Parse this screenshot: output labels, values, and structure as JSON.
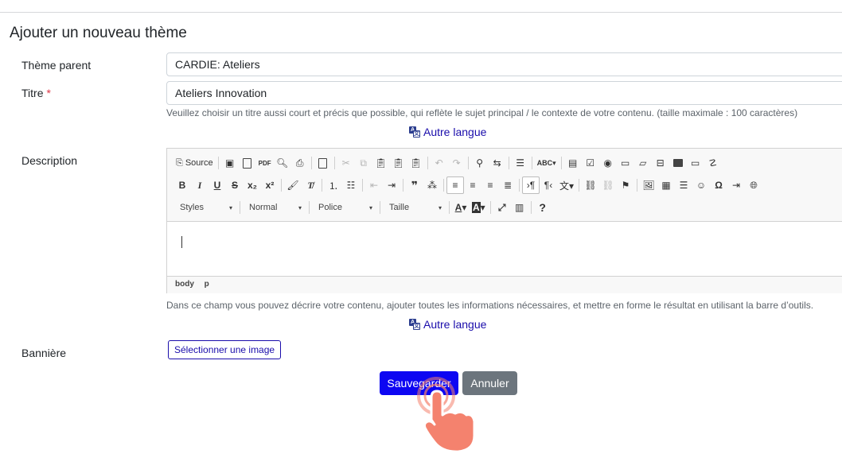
{
  "page_title": "Ajouter un nouveau thème",
  "parent_theme": {
    "label": "Thème parent",
    "value": "CARDIE: Ateliers"
  },
  "title_field": {
    "label": "Titre",
    "required_mark": "*",
    "value": "Ateliers Innovation",
    "help": "Veuillez choisir un titre aussi court et précis que possible, qui reflète le sujet principal / le contexte de votre contenu. (taille maximale : 100 caractères)",
    "other_language": "Autre langue"
  },
  "description": {
    "label": "Description",
    "toolbar": {
      "source_label": "Source",
      "styles_combo": "Styles",
      "format_combo": "Normal",
      "font_combo": "Police",
      "size_combo": "Taille",
      "help_label": "?"
    },
    "status_path": [
      "body",
      "p"
    ],
    "help": "Dans ce champ vous pouvez décrire votre contenu, ajouter toutes les informations nécessaires, et mettre en forme le résultat en utilisant la barre d’outils.",
    "other_language": "Autre langue"
  },
  "banner": {
    "label": "Bannière",
    "select_button": "Sélectionner une image"
  },
  "actions": {
    "save": "Sauvegarder",
    "cancel": "Annuler"
  },
  "colors": {
    "primary": "#0d06f2",
    "secondary": "#6c757d",
    "link": "#1a0dab",
    "required": "#dc3545",
    "hand": "#f4826e"
  }
}
